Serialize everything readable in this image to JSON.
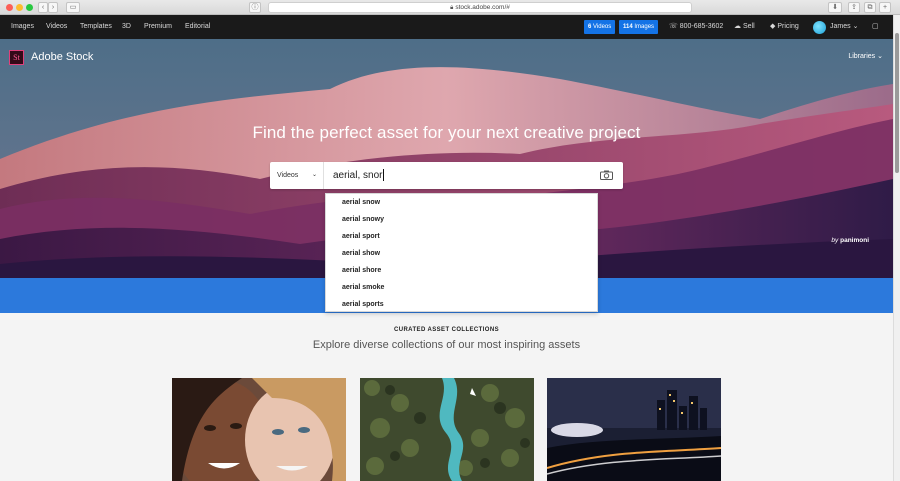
{
  "browser": {
    "url": "stock.adobe.com/#",
    "buttons": [
      "back",
      "forward",
      "sidebar",
      "reader",
      "download",
      "share",
      "tabs",
      "new-tab"
    ]
  },
  "nav": {
    "items": [
      "Images",
      "Videos",
      "Templates",
      "3D",
      "Premium",
      "Editorial"
    ],
    "videos_pill": {
      "count": "6",
      "label": "Videos"
    },
    "images_pill": {
      "count": "114",
      "label": "Images"
    },
    "phone": "800-685-3602",
    "sell": "Sell",
    "pricing": "Pricing",
    "user": "James",
    "accent": "#1473e6"
  },
  "hero": {
    "logo_mark": "St",
    "logo_text": "Adobe Stock",
    "libraries": "Libraries",
    "title": "Find the perfect asset for your next creative project",
    "credit_prefix": "by",
    "credit_name": "panimoni",
    "search": {
      "category": "Videos",
      "query": "aerial, snor"
    }
  },
  "suggestions": [
    "aerial snow",
    "aerial snowy",
    "aerial sport",
    "aerial show",
    "aerial shore",
    "aerial smoke",
    "aerial sports"
  ],
  "curated": {
    "heading": "CURATED ASSET COLLECTIONS",
    "subheading": "Explore diverse collections of our most inspiring assets"
  }
}
